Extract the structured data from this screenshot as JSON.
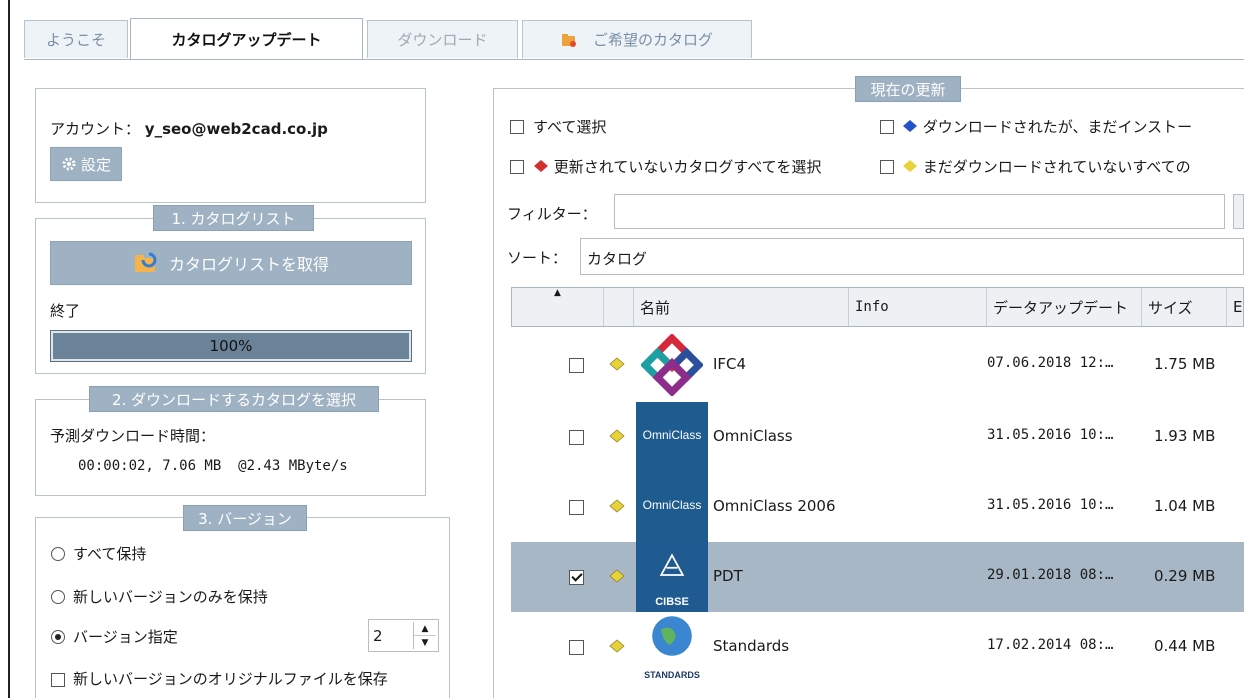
{
  "tabs": [
    {
      "label": "ようこそ",
      "state": "normal"
    },
    {
      "label": "カタログアップデート",
      "state": "active"
    },
    {
      "label": "ダウンロード",
      "state": "disabled"
    },
    {
      "label": "ご希望のカタログ",
      "state": "normal",
      "icon": "folder-heart-icon"
    }
  ],
  "left": {
    "account_label": "アカウント：",
    "account_value": "y_seo@web2cad.co.jp",
    "settings_button": "設定",
    "group1": {
      "title": "1. カタログリスト",
      "get_list_button": "カタログリストを取得",
      "status": "終了",
      "progress_text": "100%",
      "progress_value": 1.0
    },
    "group2": {
      "title": "2. ダウンロードするカタログを選択",
      "estimate_label": "予測ダウンロード時間：",
      "estimate_value": "00:00:02, 7.06 MB  @2.43 MByte/s"
    },
    "group3": {
      "title": "3. バージョン",
      "options": [
        "すべて保持",
        "新しいバージョンのみを保持",
        "バージョン指定"
      ],
      "selected_index": 2,
      "version_count": "2",
      "keep_original_label": "新しいバージョンのオリジナルファイルを保存"
    }
  },
  "right": {
    "title": "現在の更新",
    "select_all": "すべて選択",
    "downloaded_not_installed": "ダウンロードされたが、まだインストー",
    "select_not_updated": "更新されていないカタログすべてを選択",
    "not_downloaded": "まだダウンロードされていないすべての",
    "filter_label": "フィルター：",
    "filter_value": "",
    "sort_label": "ソート：",
    "sort_value": "カタログ",
    "columns": [
      "名前",
      "Info",
      "データアップデート",
      "サイズ",
      "E"
    ],
    "rows": [
      {
        "name": "IFC4",
        "date": "07.06.2018 12:…",
        "size": "1.75 MB",
        "checked": false,
        "logo_text": ""
      },
      {
        "name": "OmniClass",
        "date": "31.05.2016 10:…",
        "size": "1.93 MB",
        "checked": false,
        "logo_text": "OmniClass"
      },
      {
        "name": "OmniClass 2006",
        "date": "31.05.2016 10:…",
        "size": "1.04 MB",
        "checked": false,
        "logo_text": "OmniClass"
      },
      {
        "name": "PDT",
        "date": "29.01.2018 08:…",
        "size": "0.29 MB",
        "checked": true,
        "logo_text": "CIBSE"
      },
      {
        "name": "Standards",
        "date": "17.02.2014 08:…",
        "size": "0.44 MB",
        "checked": false,
        "logo_text": "STANDARDS"
      }
    ]
  },
  "colors": {
    "accent": "#9fb2c3",
    "selected_row": "#a7b7c5",
    "progress_fill": "#6b8399"
  }
}
